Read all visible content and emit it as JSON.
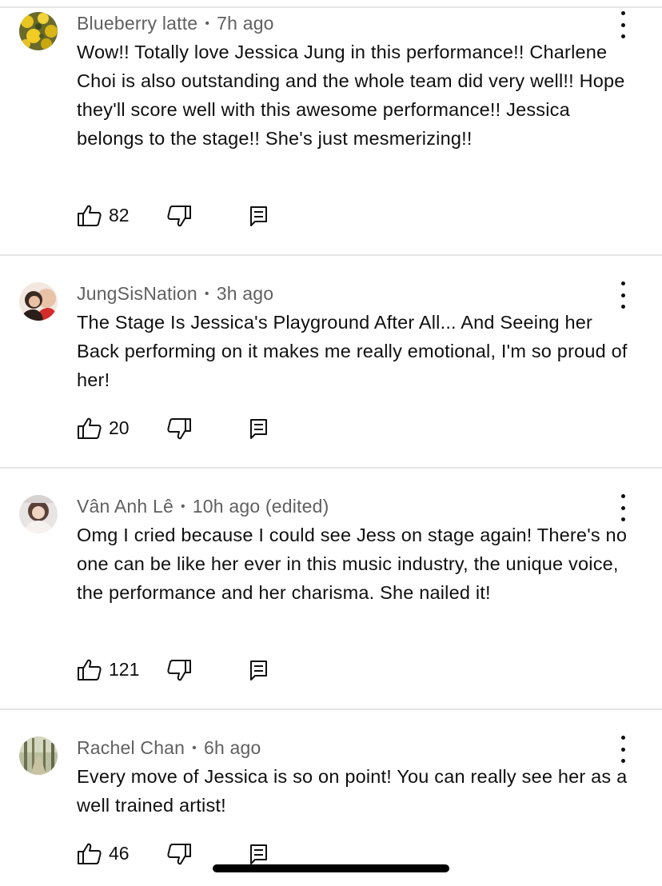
{
  "comments": [
    {
      "author": "Blueberry latte",
      "time": "7h ago",
      "text": "Wow!! Totally love Jessica Jung in this performance!! Charlene Choi is also outstanding and the whole team did very well!!  Hope they'll score well with this awesome performance!! Jessica belongs to the stage!! She's just mesmerizing!!",
      "likes": "82"
    },
    {
      "author": "JungSisNation",
      "time": "3h ago",
      "text": "The Stage Is Jessica's Playground After All... And Seeing her Back performing on it makes me really emotional, I'm so proud of her!",
      "likes": "20"
    },
    {
      "author": "Vân Anh Lê",
      "time": "10h ago (edited)",
      "text": "Omg I cried because I could see Jess on stage again! There's no one can be like her ever in this music industry, the unique voice, the performance and her charisma. She nailed it!",
      "likes": "121"
    },
    {
      "author": "Rachel Chan",
      "time": "6h ago",
      "text": "Every move of Jessica is so on point! You can really see her as a well trained artist!",
      "likes": "46"
    }
  ],
  "separator": "•",
  "icons": {
    "like": "thumbs-up-icon",
    "dislike": "thumbs-down-icon",
    "reply": "reply-icon",
    "more": "more-vertical-icon"
  }
}
